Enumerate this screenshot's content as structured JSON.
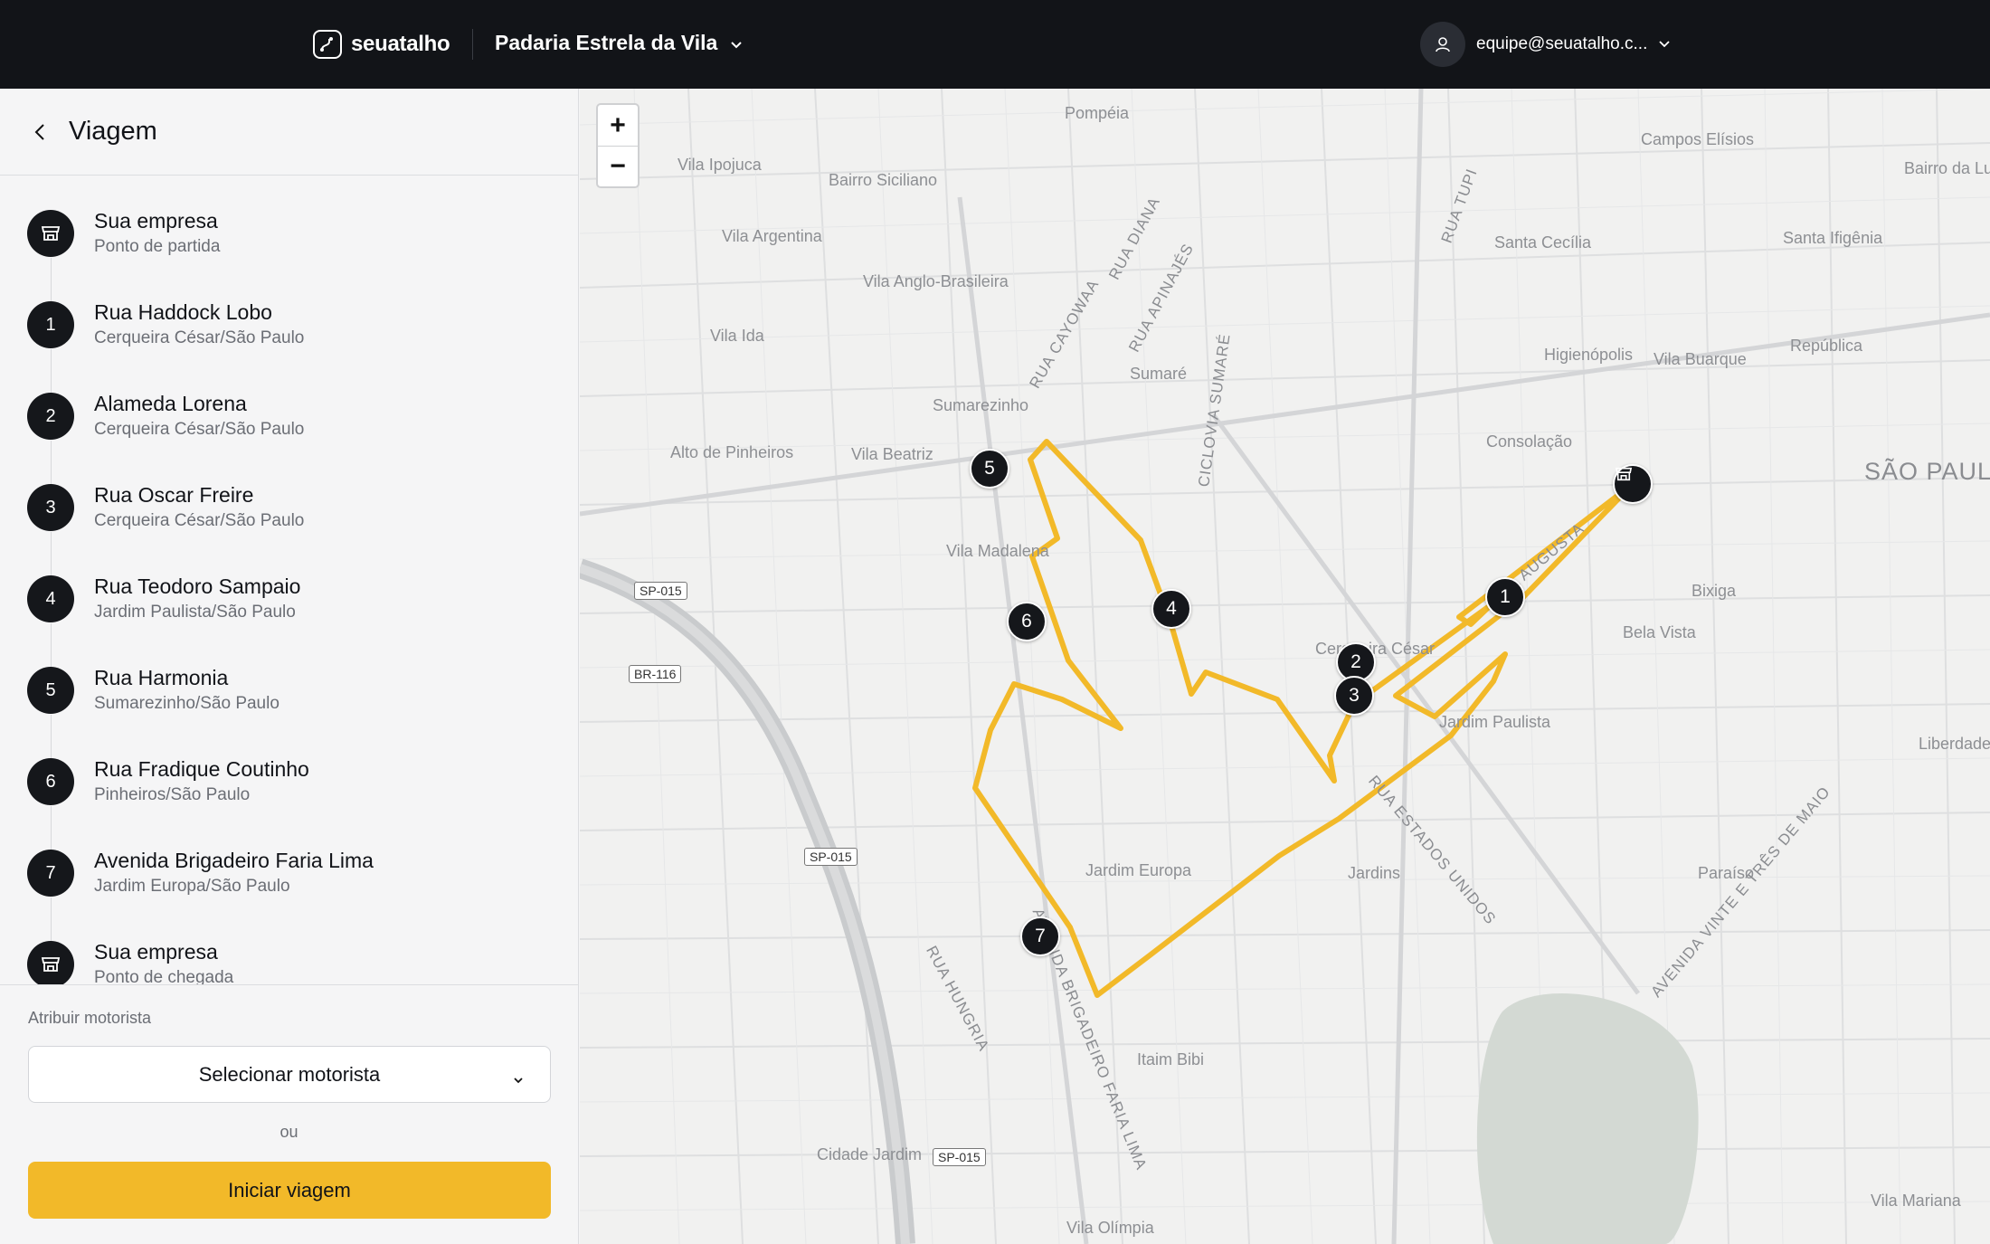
{
  "header": {
    "brand_name": "seuatalho",
    "company_name": "Padaria Estrela da Vila",
    "user_email": "equipe@seuatalho.c..."
  },
  "sidebar": {
    "title": "Viagem",
    "stops": [
      {
        "marker": "store-icon",
        "name": "Sua empresa",
        "sub": "Ponto de partida"
      },
      {
        "marker": "1",
        "name": "Rua Haddock Lobo",
        "sub": "Cerqueira César/São Paulo"
      },
      {
        "marker": "2",
        "name": "Alameda Lorena",
        "sub": "Cerqueira César/São Paulo"
      },
      {
        "marker": "3",
        "name": "Rua Oscar Freire",
        "sub": "Cerqueira César/São Paulo"
      },
      {
        "marker": "4",
        "name": "Rua Teodoro Sampaio",
        "sub": "Jardim Paulista/São Paulo"
      },
      {
        "marker": "5",
        "name": "Rua Harmonia",
        "sub": "Sumarezinho/São Paulo"
      },
      {
        "marker": "6",
        "name": "Rua Fradique Coutinho",
        "sub": "Pinheiros/São Paulo"
      },
      {
        "marker": "7",
        "name": "Avenida Brigadeiro Faria Lima",
        "sub": "Jardim Europa/São Paulo"
      },
      {
        "marker": "store-icon",
        "name": "Sua empresa",
        "sub": "Ponto de chegada"
      }
    ],
    "assign_label": "Atribuir motorista",
    "driver_select": "Selecionar motorista",
    "or_text": "ou",
    "start_button": "Iniciar viagem"
  },
  "map": {
    "zoom_in": "+",
    "zoom_out": "−",
    "route_color": "#f2b929",
    "labels": {
      "pompeia": "Pompéia",
      "campos_eliseos": "Campos Elísios",
      "barra_funda": "Bairro da Lu",
      "vila_ipojuca": "Vila Ipojuca",
      "bairro_siciliano": "Bairro Siciliano",
      "santa_cecilia": "Santa Cecília",
      "santa_ifigenia": "Santa Ifigênia",
      "vila_argentina": "Vila Argentina",
      "vila_anglo": "Vila Anglo-Brasileira",
      "vila_ida": "Vila Ida",
      "higienopolis": "Higienópolis",
      "republica": "República",
      "vila_buarque": "Vila Buarque",
      "sumare": "Sumaré",
      "sumarezinho": "Sumarezinho",
      "consolacao": "Consolação",
      "alto_pinheiros": "Alto de Pinheiros",
      "vila_beatriz": "Vila Beatriz",
      "sao_paulo": "SÃO PAULO",
      "vila_madalena": "Vila Madalena",
      "bixiga": "Bixiga",
      "bela_vista": "Bela Vista",
      "cerqueira_cesar": "Cerqueira César",
      "jardim_paulista": "Jardim Paulista",
      "liberdade": "Liberdade",
      "jardim_europa": "Jardim Europa",
      "jardins": "Jardins",
      "paraiso": "Paraíso",
      "itaim_bibi": "Itaim Bibi",
      "cidade_jardim": "Cidade Jardim",
      "vila_mariana": "Vila Mariana",
      "vila_olimpia": "Vila Olímpia"
    },
    "streets": {
      "rua_diana": "RUA DIANA",
      "rua_apinajes": "RUA APINAJÉS",
      "rua_tupi": "RUA TUPI",
      "rua_cayowaa": "RUA CAYOWAA",
      "ciclovia_sumare": "CICLOVIA SUMARÉ",
      "rua_augusta": "RUA AUGUSTA",
      "rua_estados_unidos": "RUA ESTADOS UNIDOS",
      "av_faria_lima": "AVENIDA BRIGADEIRO FARIA LIMA",
      "rua_hungria": "RUA HUNGRIA",
      "av_vinte_tres_maio": "AVENIDA VINTE E TRÊS DE MAIO"
    },
    "shields": {
      "sp015_a": "SP-015",
      "br116": "BR-116",
      "sp015_b": "SP-015",
      "sp015_c": "SP-015"
    },
    "pins": {
      "p1": "1",
      "p2": "2",
      "p3": "3",
      "p4": "4",
      "p5": "5",
      "p6": "6",
      "p7": "7"
    }
  }
}
